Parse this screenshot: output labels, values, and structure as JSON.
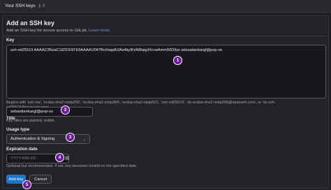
{
  "header": {
    "title": "Your SSH keys",
    "count": "0",
    "icon": "key-icon"
  },
  "card": {
    "title": "Add an SSH key",
    "description": "Add an SSH key for secure access to GitLab.",
    "link": "Learn more."
  },
  "key_field": {
    "label": "Key",
    "value": "ssh-ed25519 AAAAC3NzaC1lZDI1NTE5AAAAIJ047BnXwgdh3As4kyIKxNl9qqyfXrcwAmm50D9ys sebastiankargl@pop-os",
    "help": "Begins with 'ssh-rsa', 'ecdsa-sha2-nistp256', 'ecdsa-sha2-nistp384', 'ecdsa-sha2-nistp521', 'ssh-ed25519', 'sk-ecdsa-sha2-nistp256@openssh.com', or 'sk-ssh-ed25519@openssh.com'."
  },
  "title_field": {
    "label": "Title",
    "value": "sebastiankargl@pop-os",
    "help": "Key titles are publicly visible."
  },
  "usage_field": {
    "label": "Usage type",
    "value": "Authentication & Signing"
  },
  "expiration_field": {
    "label": "Expiration date",
    "placeholder": "YYYY-MM-DD",
    "help": "Optional but recommended. If set, key becomes invalid on the specified date."
  },
  "buttons": {
    "add": "Add key",
    "cancel": "Cancel"
  },
  "markers": [
    "1",
    "2",
    "3",
    "4",
    "5"
  ],
  "colors": {
    "primary": "#1f75cb",
    "marker": "#6a1b9a"
  }
}
